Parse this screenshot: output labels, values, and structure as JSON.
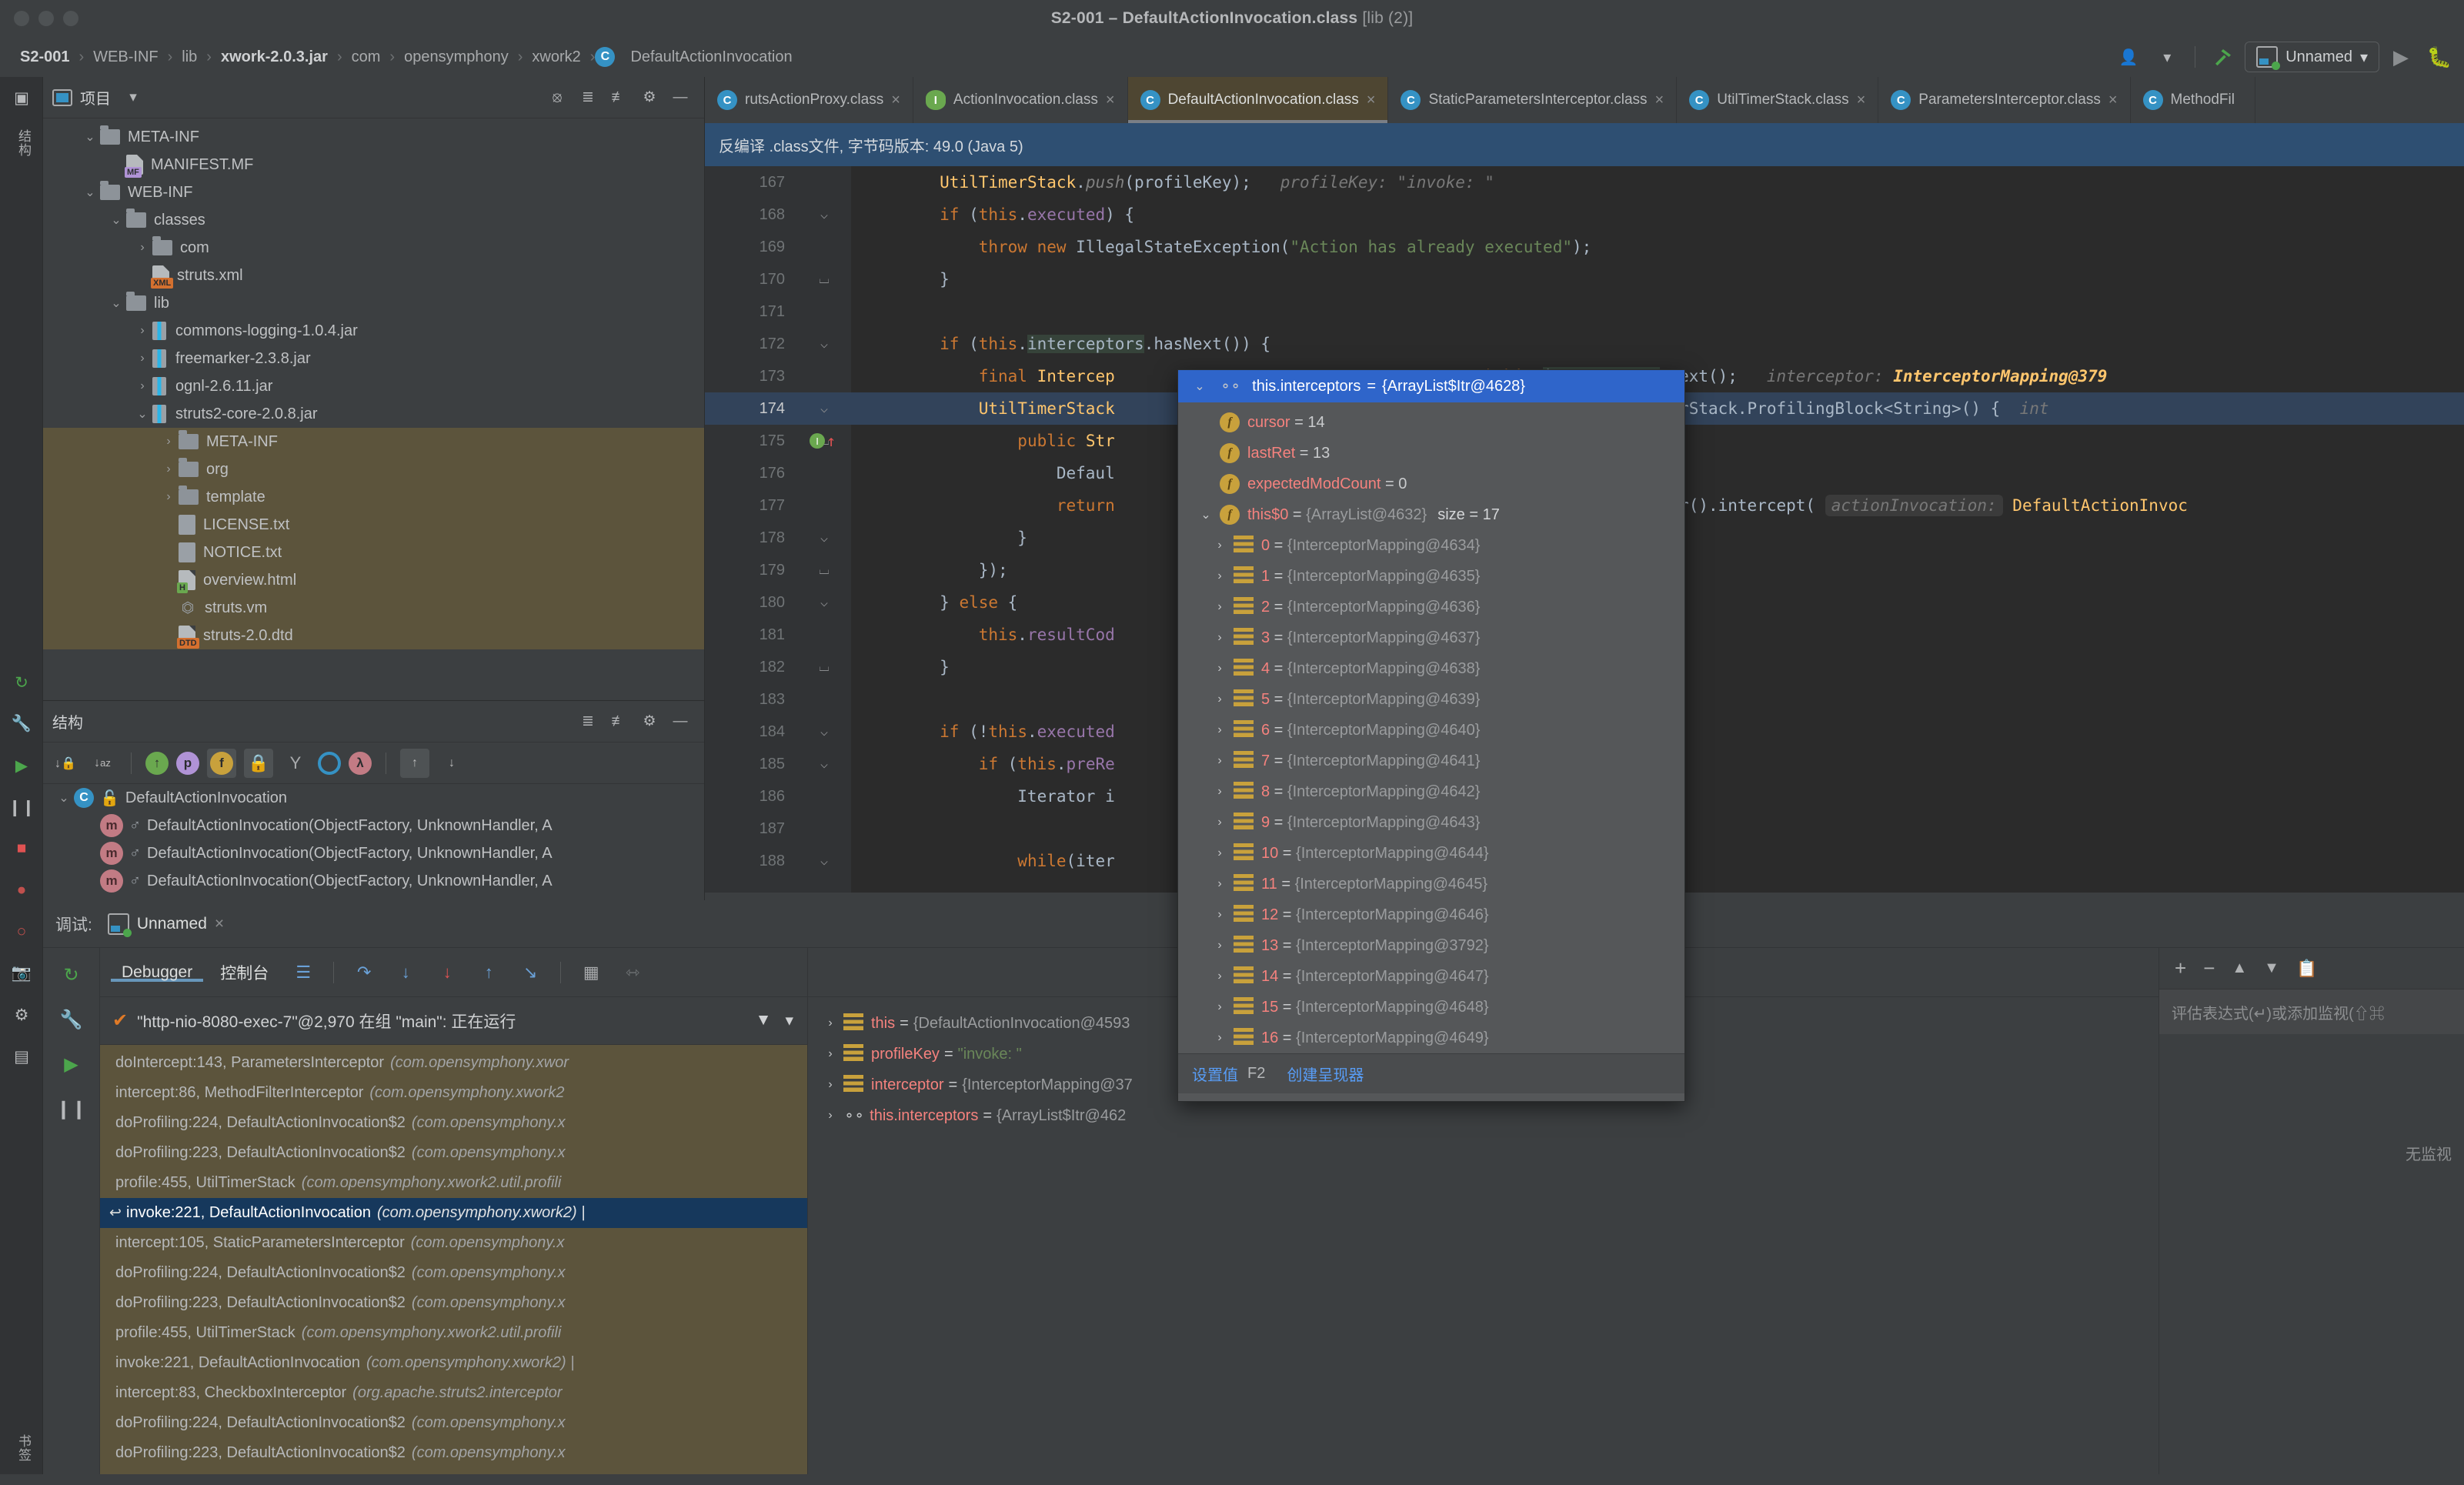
{
  "window": {
    "title_main": "S2-001 – DefaultActionInvocation.class",
    "title_dim": "[lib (2)]"
  },
  "breadcrumb": {
    "items": [
      "S2-001",
      "WEB-INF",
      "lib",
      "xwork-2.0.3.jar",
      "com",
      "opensymphony",
      "xwork2",
      "DefaultActionInvocation"
    ],
    "class_badge": "C",
    "separator": "›"
  },
  "toolbar": {
    "user_icon": "user-icon",
    "dropdown_caret": "▾",
    "build_icon": "hammer-icon",
    "run_config_name": "Unnamed",
    "run_icon": "▶",
    "debug_icon": "bug-icon"
  },
  "left_rail": {
    "labels": [
      "结构",
      "书签"
    ],
    "icons": [
      "project-icon",
      "commit-icon",
      "wrench-icon",
      "resume-icon",
      "pause-icon",
      "stop-icon",
      "mute-breakpoints-icon",
      "view-breakpoints-icon",
      "camera-icon",
      "settings-icon",
      "layout-icon"
    ]
  },
  "project_panel": {
    "title": "项目",
    "caret": "▾",
    "header_icons": [
      "locate-icon",
      "expand-all-icon",
      "collapse-all-icon",
      "gear-icon",
      "hide-icon"
    ],
    "tree": [
      {
        "label": "META-INF",
        "type": "folder",
        "arrow": "⌄",
        "indent": 1,
        "selected": false
      },
      {
        "label": "MANIFEST.MF",
        "type": "file",
        "tag": "MF",
        "arrow": "",
        "indent": 2,
        "selected": false
      },
      {
        "label": "WEB-INF",
        "type": "folder",
        "arrow": "⌄",
        "indent": 1,
        "selected": false
      },
      {
        "label": "classes",
        "type": "folder",
        "arrow": "⌄",
        "indent": 2,
        "selected": false
      },
      {
        "label": "com",
        "type": "folder",
        "arrow": "›",
        "indent": 3,
        "selected": false
      },
      {
        "label": "struts.xml",
        "type": "file",
        "tag": "XML",
        "arrow": "",
        "indent": 3,
        "selected": false
      },
      {
        "label": "lib",
        "type": "folder",
        "arrow": "⌄",
        "indent": 2,
        "selected": false
      },
      {
        "label": "commons-logging-1.0.4.jar",
        "type": "jar",
        "arrow": "›",
        "indent": 3,
        "selected": false
      },
      {
        "label": "freemarker-2.3.8.jar",
        "type": "jar",
        "arrow": "›",
        "indent": 3,
        "selected": false
      },
      {
        "label": "ognl-2.6.11.jar",
        "type": "jar",
        "arrow": "›",
        "indent": 3,
        "selected": false
      },
      {
        "label": "struts2-core-2.0.8.jar",
        "type": "jar",
        "arrow": "⌄",
        "indent": 3,
        "selected": false
      },
      {
        "label": "META-INF",
        "type": "folder",
        "arrow": "›",
        "indent": 4,
        "selected": true
      },
      {
        "label": "org",
        "type": "folder",
        "arrow": "›",
        "indent": 4,
        "selected": true
      },
      {
        "label": "template",
        "type": "folder",
        "arrow": "›",
        "indent": 4,
        "selected": true
      },
      {
        "label": "LICENSE.txt",
        "type": "txt",
        "arrow": "",
        "indent": 4,
        "selected": true
      },
      {
        "label": "NOTICE.txt",
        "type": "txt",
        "arrow": "",
        "indent": 4,
        "selected": true
      },
      {
        "label": "overview.html",
        "type": "file",
        "tag": "H",
        "arrow": "",
        "indent": 4,
        "selected": true
      },
      {
        "label": "struts.vm",
        "type": "vm",
        "arrow": "",
        "indent": 4,
        "selected": true
      },
      {
        "label": "struts-2.0.dtd",
        "type": "file",
        "tag": "DTD",
        "arrow": "",
        "indent": 4,
        "selected": true
      }
    ]
  },
  "structure_panel": {
    "title": "结构",
    "header_icons": [
      "expand-all-icon",
      "collapse-all-icon",
      "gear-icon",
      "hide-icon"
    ],
    "tool_icons": [
      "sort-by-visibility-icon",
      "sort-alphabetically-icon",
      "show-inherited-icon",
      "show-properties-icon",
      "show-fields-icon",
      "show-non-public-icon",
      "show-anonymous-icon",
      "show-interfaces-icon",
      "show-lambdas-icon",
      "scroll-from-source-icon",
      "scroll-to-source-icon"
    ],
    "rows": [
      {
        "label": "DefaultActionInvocation",
        "kind": "class",
        "arrow": "⌄",
        "indent": 0
      },
      {
        "label": "DefaultActionInvocation(ObjectFactory, UnknownHandler, A",
        "kind": "method",
        "arrow": "",
        "indent": 1
      },
      {
        "label": "DefaultActionInvocation(ObjectFactory, UnknownHandler, A",
        "kind": "method",
        "arrow": "",
        "indent": 1
      },
      {
        "label": "DefaultActionInvocation(ObjectFactory, UnknownHandler, A",
        "kind": "method",
        "arrow": "",
        "indent": 1
      }
    ]
  },
  "editor": {
    "tabs": [
      {
        "label": "rutsActionProxy.class",
        "icon": "class-icon",
        "kind": "class",
        "active": false,
        "close": "×"
      },
      {
        "label": "ActionInvocation.class",
        "icon": "interface-icon",
        "kind": "interface",
        "active": false,
        "close": "×"
      },
      {
        "label": "DefaultActionInvocation.class",
        "icon": "class-icon",
        "kind": "class",
        "active": true,
        "close": "×"
      },
      {
        "label": "StaticParametersInterceptor.class",
        "icon": "class-icon",
        "kind": "class",
        "active": false,
        "close": "×"
      },
      {
        "label": "UtilTimerStack.class",
        "icon": "class-icon",
        "kind": "class",
        "active": false,
        "close": "×"
      },
      {
        "label": "ParametersInterceptor.class",
        "icon": "class-icon",
        "kind": "class",
        "active": false,
        "close": "×"
      },
      {
        "label": "MethodFil",
        "icon": "class-icon",
        "kind": "class",
        "active": false,
        "close": ""
      }
    ],
    "decompiled_banner": "反编译 .class文件, 字节码版本: 49.0 (Java 5)",
    "lines": [
      {
        "n": "167",
        "fold": "",
        "code_html": "        <span class='st'>UtilTimerStack</span>.<span class='cm'>push</span>(profileKey);   <span class='hint'>profileKey: \"invoke: \"</span>",
        "state": ""
      },
      {
        "n": "168",
        "fold": "⌵",
        "code_html": "        <span class='k'>if</span> (<span class='k'>this</span>.<span class='f'>executed</span>) {",
        "state": ""
      },
      {
        "n": "169",
        "fold": "",
        "code_html": "            <span class='k'>throw</span> <span class='k'>new</span> IllegalStateException(<span class='s'>\"Action has already executed\"</span>);",
        "state": ""
      },
      {
        "n": "170",
        "fold": "⌴",
        "code_html": "        }",
        "state": ""
      },
      {
        "n": "171",
        "fold": "",
        "code_html": "",
        "state": ""
      },
      {
        "n": "172",
        "fold": "⌵",
        "code_html": "        <span class='k'>if</span> (<span class='k'>this</span>.<span class='idhl'>interceptors</span>.hasNext()) {",
        "state": ""
      },
      {
        "n": "173",
        "fold": "",
        "code_html": "            <span class='k'>final</span> <span class='st'>Intercep</span>&nbsp;&nbsp;&nbsp;&nbsp;&nbsp;&nbsp;&nbsp;&nbsp;&nbsp;&nbsp;&nbsp;&nbsp;&nbsp;&nbsp;&nbsp;&nbsp;&nbsp;&nbsp;&nbsp;&nbsp;&nbsp;&nbsp;&nbsp;&nbsp;&nbsp;&nbsp;&nbsp;&nbsp;&nbsp;&nbsp;&nbsp;&nbsp;&nbsp;&nbsp;&nbsp;&nbsp;<span class='k'>ng)</span><span class='k'>this</span>.<span class='idhl'>interceptors</span>.next();   <span class='hint'>interceptor: </span><span class='hintv'>InterceptorMapping@379</span>",
        "state": ""
      },
      {
        "n": "174",
        "fold": "⌵",
        "code_html": "            <span class='st'>UtilTimerStack</span>&nbsp;&nbsp;&nbsp;&nbsp;&nbsp;&nbsp;&nbsp;&nbsp;&nbsp;&nbsp;&nbsp;&nbsp;&nbsp;&nbsp;&nbsp;&nbsp;&nbsp;&nbsp;&nbsp;&nbsp;&nbsp;&nbsp;&nbsp;&nbsp;&nbsp;&nbsp;&nbsp;&nbsp;&nbsp;&nbsp;&nbsp;&nbsp;or.getName(), <span class='k'>new</span> UtilTimerStack.ProfilingBlock&lt;String&gt;() {  <span class='hint'>int</span>",
        "state": "hl"
      },
      {
        "n": "175",
        "fold": "⌴",
        "code_html": "                <span class='k'>public</span> <span class='st'>Str</span>",
        "state": "",
        "breakpoint": true
      },
      {
        "n": "176",
        "fold": "",
        "code_html": "                    Defaul",
        "state": ""
      },
      {
        "n": "177",
        "fold": "",
        "code_html": "                    <span class='k'>return</span>&nbsp;&nbsp;&nbsp;&nbsp;&nbsp;&nbsp;&nbsp;&nbsp;&nbsp;&nbsp;&nbsp;&nbsp;&nbsp;&nbsp;&nbsp;&nbsp;&nbsp;&nbsp;&nbsp;&nbsp;&nbsp;&nbsp;&nbsp;&nbsp;&nbsp;&nbsp;&nbsp;&nbsp;&nbsp;&nbsp;&nbsp;&nbsp;&nbsp;&nbsp;&nbsp;&nbsp;&nbsp;&nbsp;&nbsp;<span class='f'>eptor</span>.getInterceptor().intercept( <span class='pill'>actionInvocation:</span> <span class='st'>DefaultActionInvoc</span>",
        "state": ""
      },
      {
        "n": "178",
        "fold": "⌵",
        "code_html": "                }",
        "state": ""
      },
      {
        "n": "179",
        "fold": "⌴",
        "code_html": "            });",
        "state": ""
      },
      {
        "n": "180",
        "fold": "⌵",
        "code_html": "        } <span class='k'>else</span> {",
        "state": ""
      },
      {
        "n": "181",
        "fold": "",
        "code_html": "            <span class='k'>this</span>.<span class='f'>resultCod</span>",
        "state": ""
      },
      {
        "n": "182",
        "fold": "⌴",
        "code_html": "        }",
        "state": ""
      },
      {
        "n": "183",
        "fold": "",
        "code_html": "",
        "state": ""
      },
      {
        "n": "184",
        "fold": "⌵",
        "code_html": "        <span class='k'>if</span> (!<span class='k'>this</span>.<span class='f'>executed</span>",
        "state": ""
      },
      {
        "n": "185",
        "fold": "⌵",
        "code_html": "            <span class='k'>if</span> (<span class='k'>this</span>.<span class='f'>preRe</span>",
        "state": ""
      },
      {
        "n": "186",
        "fold": "",
        "code_html": "                Iterator i",
        "state": ""
      },
      {
        "n": "187",
        "fold": "",
        "code_html": "",
        "state": ""
      },
      {
        "n": "188",
        "fold": "⌵",
        "code_html": "                <span class='k'>while</span>(iter",
        "state": ""
      }
    ],
    "right_fragments": [
      "();",
      "().;"
    ]
  },
  "popup": {
    "header": {
      "chevron": "⌄",
      "icon": "watch-glasses-icon",
      "name": "this.interceptors",
      "equals": "=",
      "value": "{ArrayList$Itr@4628}"
    },
    "rows": [
      {
        "chevron": "",
        "icon": "field",
        "name": "cursor",
        "value": "14",
        "value_kind": "num",
        "indent": 1
      },
      {
        "chevron": "",
        "icon": "field",
        "name": "lastRet",
        "value": "13",
        "value_kind": "num",
        "indent": 1
      },
      {
        "chevron": "",
        "icon": "field",
        "name": "expectedModCount",
        "value": "0",
        "value_kind": "num",
        "indent": 1
      },
      {
        "chevron": "⌄",
        "icon": "field",
        "name": "this$0",
        "value": "{ArrayList@4632}",
        "value_kind": "ref",
        "size": "size = 17",
        "indent": 1
      },
      {
        "chevron": "›",
        "icon": "list",
        "name": "0",
        "value": "{InterceptorMapping@4634}",
        "value_kind": "ref",
        "indent": 2
      },
      {
        "chevron": "›",
        "icon": "list",
        "name": "1",
        "value": "{InterceptorMapping@4635}",
        "value_kind": "ref",
        "indent": 2
      },
      {
        "chevron": "›",
        "icon": "list",
        "name": "2",
        "value": "{InterceptorMapping@4636}",
        "value_kind": "ref",
        "indent": 2
      },
      {
        "chevron": "›",
        "icon": "list",
        "name": "3",
        "value": "{InterceptorMapping@4637}",
        "value_kind": "ref",
        "indent": 2
      },
      {
        "chevron": "›",
        "icon": "list",
        "name": "4",
        "value": "{InterceptorMapping@4638}",
        "value_kind": "ref",
        "indent": 2
      },
      {
        "chevron": "›",
        "icon": "list",
        "name": "5",
        "value": "{InterceptorMapping@4639}",
        "value_kind": "ref",
        "indent": 2
      },
      {
        "chevron": "›",
        "icon": "list",
        "name": "6",
        "value": "{InterceptorMapping@4640}",
        "value_kind": "ref",
        "indent": 2
      },
      {
        "chevron": "›",
        "icon": "list",
        "name": "7",
        "value": "{InterceptorMapping@4641}",
        "value_kind": "ref",
        "indent": 2
      },
      {
        "chevron": "›",
        "icon": "list",
        "name": "8",
        "value": "{InterceptorMapping@4642}",
        "value_kind": "ref",
        "indent": 2
      },
      {
        "chevron": "›",
        "icon": "list",
        "name": "9",
        "value": "{InterceptorMapping@4643}",
        "value_kind": "ref",
        "indent": 2
      },
      {
        "chevron": "›",
        "icon": "list",
        "name": "10",
        "value": "{InterceptorMapping@4644}",
        "value_kind": "ref",
        "indent": 2
      },
      {
        "chevron": "›",
        "icon": "list",
        "name": "11",
        "value": "{InterceptorMapping@4645}",
        "value_kind": "ref",
        "indent": 2
      },
      {
        "chevron": "›",
        "icon": "list",
        "name": "12",
        "value": "{InterceptorMapping@4646}",
        "value_kind": "ref",
        "indent": 2
      },
      {
        "chevron": "›",
        "icon": "list",
        "name": "13",
        "value": "{InterceptorMapping@3792}",
        "value_kind": "ref",
        "indent": 2
      },
      {
        "chevron": "›",
        "icon": "list",
        "name": "14",
        "value": "{InterceptorMapping@4647}",
        "value_kind": "ref",
        "indent": 2
      },
      {
        "chevron": "›",
        "icon": "list",
        "name": "15",
        "value": "{InterceptorMapping@4648}",
        "value_kind": "ref",
        "indent": 2
      },
      {
        "chevron": "›",
        "icon": "list",
        "name": "16",
        "value": "{InterceptorMapping@4649}",
        "value_kind": "ref",
        "indent": 2
      }
    ],
    "footer": {
      "set_value_label": "设置值",
      "set_value_key": "F2",
      "create_renderer_label": "创建呈现器"
    }
  },
  "debug_panel": {
    "label": "调试:",
    "session_tab": "Unnamed",
    "session_close": "×",
    "tabs": [
      {
        "label": "Debugger",
        "active": true
      },
      {
        "label": "控制台",
        "active": false
      }
    ],
    "step_icons": [
      "layout-icon",
      "step-over-icon",
      "step-into-icon",
      "force-step-into-icon",
      "step-out-icon",
      "run-to-cursor-icon",
      "evaluate-icon",
      "show-execution-point-icon"
    ],
    "rail_icons": [
      "rerun-icon",
      "settings-wrench-icon",
      "resume-icon",
      "pause-icon"
    ],
    "thread": {
      "check": "✔",
      "text": "\"http-nio-8080-exec-7\"@2,970 在组 \"main\": 正在运行",
      "filter_icon": "filter-icon",
      "caret": "▾"
    },
    "frames": [
      {
        "method": "doIntercept:143, ParametersInterceptor",
        "pkg": "(com.opensymphony.xwor",
        "selected": false,
        "ret": ""
      },
      {
        "method": "intercept:86, MethodFilterInterceptor",
        "pkg": "(com.opensymphony.xwork2",
        "selected": false,
        "ret": ""
      },
      {
        "method": "doProfiling:224, DefaultActionInvocation$2",
        "pkg": "(com.opensymphony.x",
        "selected": false,
        "ret": ""
      },
      {
        "method": "doProfiling:223, DefaultActionInvocation$2",
        "pkg": "(com.opensymphony.x",
        "selected": false,
        "ret": ""
      },
      {
        "method": "profile:455, UtilTimerStack",
        "pkg": "(com.opensymphony.xwork2.util.profili",
        "selected": false,
        "ret": ""
      },
      {
        "method": "invoke:221, DefaultActionInvocation",
        "pkg": "(com.opensymphony.xwork2) |",
        "selected": true,
        "ret": "↩"
      },
      {
        "method": "intercept:105, StaticParametersInterceptor",
        "pkg": "(com.opensymphony.x",
        "selected": false,
        "ret": ""
      },
      {
        "method": "doProfiling:224, DefaultActionInvocation$2",
        "pkg": "(com.opensymphony.x",
        "selected": false,
        "ret": ""
      },
      {
        "method": "doProfiling:223, DefaultActionInvocation$2",
        "pkg": "(com.opensymphony.x",
        "selected": false,
        "ret": ""
      },
      {
        "method": "profile:455, UtilTimerStack",
        "pkg": "(com.opensymphony.xwork2.util.profili",
        "selected": false,
        "ret": ""
      },
      {
        "method": "invoke:221, DefaultActionInvocation",
        "pkg": "(com.opensymphony.xwork2) |",
        "selected": false,
        "ret": ""
      },
      {
        "method": "intercept:83, CheckboxInterceptor",
        "pkg": "(org.apache.struts2.interceptor",
        "selected": false,
        "ret": ""
      },
      {
        "method": "doProfiling:224, DefaultActionInvocation$2",
        "pkg": "(com.opensymphony.x",
        "selected": false,
        "ret": ""
      },
      {
        "method": "doProfiling:223, DefaultActionInvocation$2",
        "pkg": "(com.opensymphony.x",
        "selected": false,
        "ret": ""
      }
    ],
    "variables": [
      {
        "chevron": "›",
        "icon": "list",
        "name": "this",
        "value": "{DefaultActionInvocation@4593",
        "kind": "ref"
      },
      {
        "chevron": "›",
        "icon": "list",
        "name": "profileKey",
        "value": "\"invoke: \"",
        "kind": "str"
      },
      {
        "chevron": "›",
        "icon": "list",
        "name": "interceptor",
        "value": "{InterceptorMapping@37",
        "kind": "ref"
      },
      {
        "chevron": "›",
        "icon": "glasses",
        "name": "this.interceptors",
        "value": "{ArrayList$Itr@462",
        "kind": "ref"
      }
    ],
    "watches": {
      "tool_icons": [
        "add-icon",
        "remove-icon",
        "move-up-icon",
        "move-down-icon",
        "copy-icon"
      ],
      "placeholder": "评估表达式(↵)或添加监视(⇧⌘",
      "empty_text": "无监视"
    }
  },
  "colors": {
    "accent_blue": "#3592c4",
    "selection_blue": "#2f65ca",
    "frame_selected": "#16385c",
    "tree_selected": "#5c543c",
    "editor_bg": "#2b2b2b",
    "panel_bg": "#3c3f41",
    "banner_blue": "#2e4f72",
    "green": "#4ca64c",
    "orange": "#cc7832",
    "pink": "#f5827e"
  }
}
